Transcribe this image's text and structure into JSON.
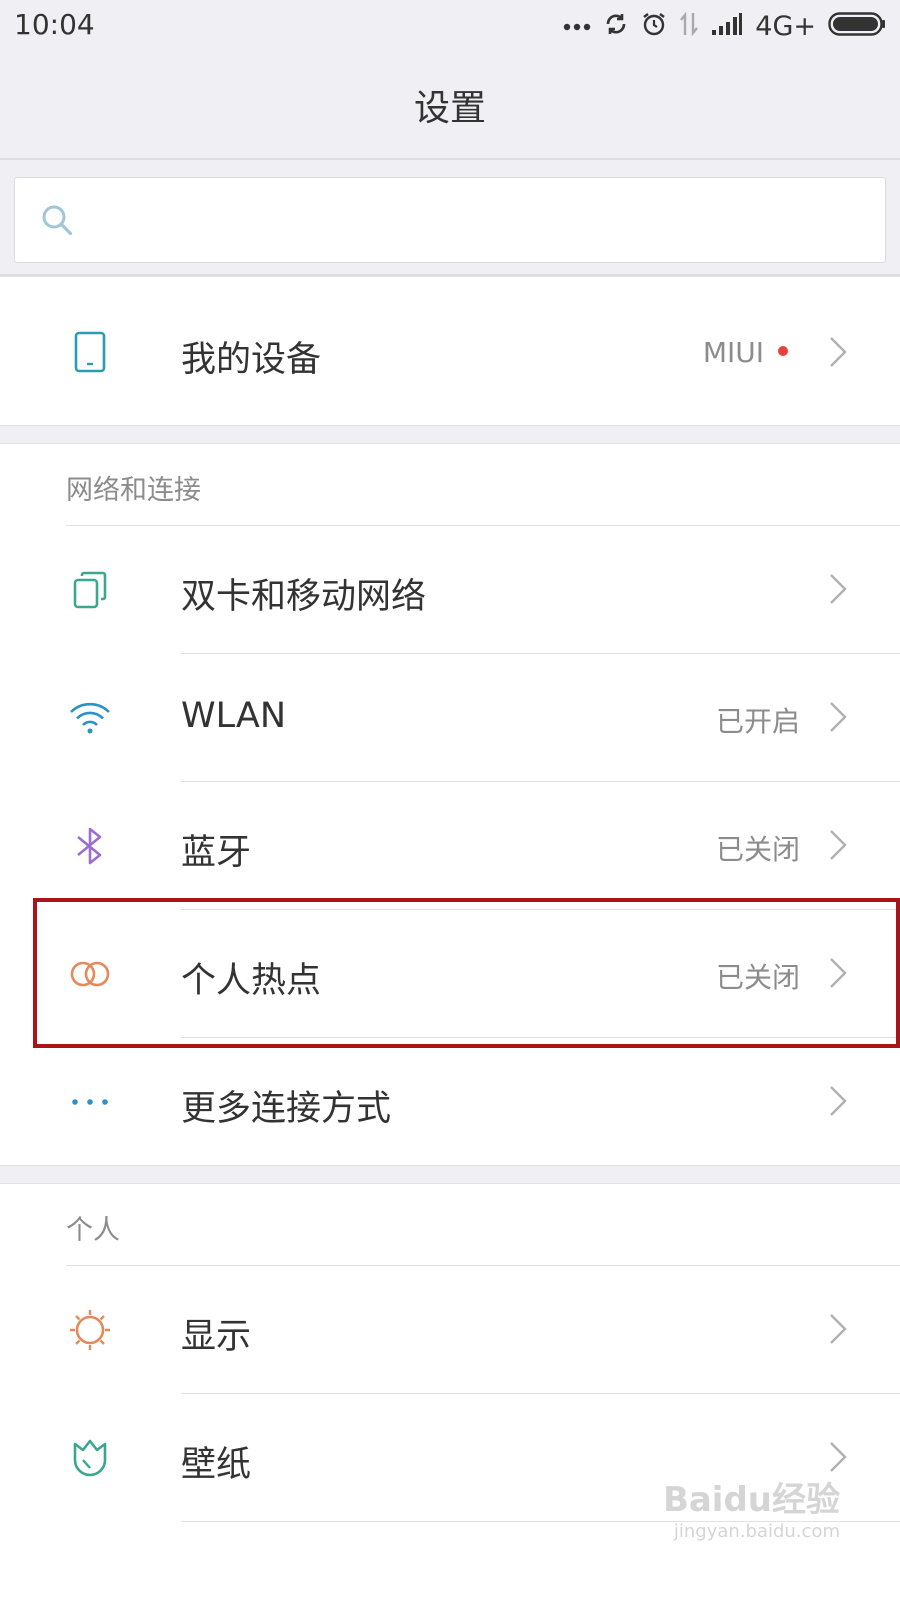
{
  "status_bar": {
    "time": "10:04",
    "network": "4G+"
  },
  "header": {
    "title": "设置"
  },
  "search": {
    "placeholder": ""
  },
  "my_device": {
    "label": "我的设备",
    "value": "MIUI"
  },
  "network_section": {
    "header": "网络和连接",
    "items": [
      {
        "label": "双卡和移动网络",
        "value": "",
        "icon": "dual-sim-icon"
      },
      {
        "label": "WLAN",
        "value": "已开启",
        "icon": "wifi-icon"
      },
      {
        "label": "蓝牙",
        "value": "已关闭",
        "icon": "bluetooth-icon"
      },
      {
        "label": "个人热点",
        "value": "已关闭",
        "icon": "hotspot-icon"
      },
      {
        "label": "更多连接方式",
        "value": "",
        "icon": "more-dots-icon"
      }
    ]
  },
  "personal_section": {
    "header": "个人",
    "items": [
      {
        "label": "显示",
        "value": "",
        "icon": "display-sun-icon"
      },
      {
        "label": "壁纸",
        "value": "",
        "icon": "wallpaper-icon"
      }
    ]
  },
  "watermark": {
    "brand": "Baidu经验",
    "url": "jingyan.baidu.com"
  },
  "colors": {
    "background": "#efeff4",
    "highlight_border": "#a8141a",
    "badge_dot": "#e8413b"
  }
}
